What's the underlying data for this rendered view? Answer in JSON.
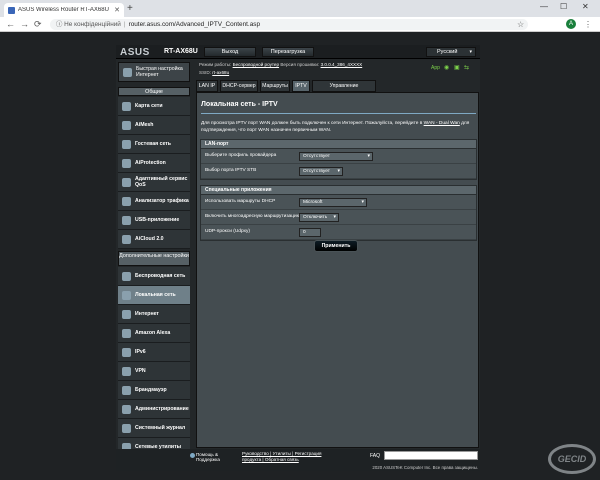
{
  "browser": {
    "tab_title": "ASUS Wireless Router RT-AX68U",
    "new_tab": "+",
    "security_label": "Не конфіденційний",
    "url": "router.asus.com/Advanced_IPTV_Content.asp",
    "profile_initial": "A",
    "window_controls": [
      "—",
      "☐",
      "✕"
    ],
    "back": "←",
    "forward": "→",
    "reload": "⟳",
    "close_tab": "✕"
  },
  "router": {
    "logo": "ASUS",
    "model": "RT-AX68U",
    "logout": "Выход",
    "reboot": "Перезагрузка",
    "language": "Русский",
    "info": {
      "mode_label": "Режим работы:",
      "mode_value": "Беспроводной роутер",
      "fw_label": "Версия прошивки:",
      "fw_value": "3.0.0.4_386_4XXXX",
      "ssid_label": "SSID:",
      "ssid_value": "rt-ax68u",
      "app_label": "App"
    },
    "subtabs": [
      "LAN IP",
      "DHCP-сервер",
      "Маршруты",
      "IPTV",
      "Управление коммутатором"
    ],
    "active_subtab": "IPTV"
  },
  "sidebar": {
    "qis_label": "Быстрая настройка Интернет",
    "general_header": "Общие",
    "general_items": [
      "Карта сети",
      "AiMesh",
      "Гостевая сеть",
      "AiProtection",
      "Адаптивный сервис QoS",
      "Анализатор трафика",
      "USB-приложение",
      "AiCloud 2.0"
    ],
    "advanced_header": "Дополнительные настройки",
    "advanced_items": [
      "Беспроводная сеть",
      "Локальная сеть",
      "Интернет",
      "Amazon Alexa",
      "IPv6",
      "VPN",
      "Брандмауэр",
      "Администрирование",
      "Системный журнал",
      "Сетевые утилиты"
    ],
    "active_item": "Локальная сеть"
  },
  "content": {
    "title": "Локальная сеть - IPTV",
    "description": "Для просмотра IPTV порт WAN должен быть подключен к сети Интернет. Пожалуйста, перейдите в ",
    "description_link": "WAN - Dual Wan",
    "description_end": " для подтверждения, что порт WAN назначен первичным WAN.",
    "lan_port_header": "LAN-порт",
    "profile_label": "Выберите профиль провайдера",
    "profile_value": "Отсутствует",
    "stb_label": "Выбор порта IPTV STB",
    "stb_value": "Отсутствует",
    "special_header": "Специальные приложения",
    "dhcp_label": "Использовать маршруты DHCP",
    "dhcp_value": "Microsoft",
    "multicast_label": "Включить многоадресную маршрутизацию",
    "multicast_value": "Отключить",
    "udp_label": "UDP-прокси (Udpxy)",
    "udp_value": "0",
    "apply": "Применить"
  },
  "footer": {
    "help": "Помощь & Поддержка",
    "links_line1": "Руководство | Утилиты | Регистрация",
    "links_line2": "продукта | Обратная связь",
    "faq": "FAQ",
    "copyright": "2020 ASUSTeK Computer Inc. Все права защищены."
  },
  "watermark": "GECID"
}
